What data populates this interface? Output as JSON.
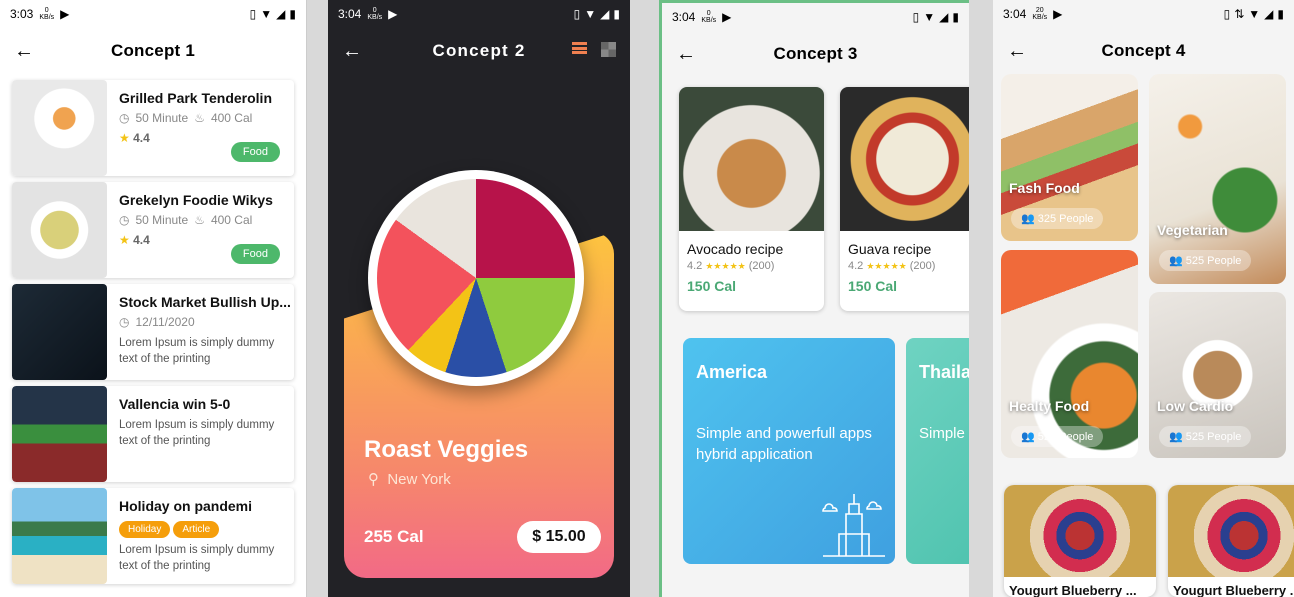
{
  "phone1": {
    "status_time": "3:03",
    "status_kb": "0",
    "title": "Concept 1",
    "cards": [
      {
        "title": "Grilled Park Tenderolin",
        "time": "50 Minute",
        "cal": "400 Cal",
        "rating": "4.4",
        "pill": "Food"
      },
      {
        "title": "Grekelyn Foodie Wikys",
        "time": "50 Minute",
        "cal": "400 Cal",
        "rating": "4.4",
        "pill": "Food"
      },
      {
        "title": "Stock Market Bullish Up...",
        "date": "12/11/2020",
        "desc": "Lorem Ipsum is simply dummy text of the printing"
      },
      {
        "title": "Vallencia win 5-0",
        "desc": "Lorem Ipsum is simply dummy text of the printing"
      },
      {
        "title": "Holiday on pandemi",
        "tags": [
          "Holiday",
          "Article"
        ],
        "desc": "Lorem Ipsum is simply dummy text of the printing"
      }
    ]
  },
  "phone2": {
    "status_time": "3:04",
    "status_kb": "0",
    "title": "Concept 2",
    "dish": "Roast Veggies",
    "location": "New York",
    "cal": "255 Cal",
    "price": "$ 15.00"
  },
  "phone3": {
    "status_time": "3:04",
    "status_kb": "0",
    "title": "Concept 3",
    "recipes": [
      {
        "title": "Avocado recipe",
        "rating": "4.2",
        "reviews": "(200)",
        "cal": "150 Cal"
      },
      {
        "title": "Guava recipe",
        "rating": "4.2",
        "reviews": "(200)",
        "cal": "150 Cal"
      }
    ],
    "destinations": [
      {
        "title": "America",
        "desc": "Simple and powerfull apps hybrid application"
      },
      {
        "title": "Thaila",
        "desc": "Simple hybrid"
      }
    ]
  },
  "phone4": {
    "status_time": "3:04",
    "status_kb": "20",
    "title": "Concept 4",
    "categories": [
      {
        "label": "Fash Food",
        "people": "325 People"
      },
      {
        "label": "Vegetarian",
        "people": "525 People"
      },
      {
        "label": "Healty Food",
        "people": "525 People"
      },
      {
        "label": "Low Cardio",
        "people": "525 People"
      }
    ],
    "products": [
      {
        "title": "Yougurt Blueberry ..."
      },
      {
        "title": "Yougurt Blueberry ..."
      }
    ]
  },
  "colors": {
    "green": "#4db86b",
    "orange": "#f59e0b",
    "blue": "#49b6ec",
    "teal": "#5cc9b0"
  }
}
